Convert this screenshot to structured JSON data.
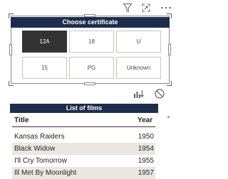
{
  "header_icons": [
    "filter-icon",
    "focus-mode-icon",
    "more-options-icon"
  ],
  "slicer": {
    "title": "Choose certificate",
    "options": [
      {
        "label": "12A",
        "selected": true
      },
      {
        "label": "18",
        "selected": false
      },
      {
        "label": "U",
        "selected": false
      },
      {
        "label": "15",
        "selected": false
      },
      {
        "label": "PG",
        "selected": false
      },
      {
        "label": "Unknown",
        "selected": false
      }
    ]
  },
  "visual_tools": [
    "drill-icon",
    "no-filter-icon"
  ],
  "table": {
    "title": "List of films",
    "columns": [
      "Title",
      "Year"
    ],
    "rows": [
      [
        "Kansas Raiders",
        "1950"
      ],
      [
        "Black Widow",
        "1954"
      ],
      [
        "I'll Cry Tomorrow",
        "1955"
      ],
      [
        "Ill Met By Moonlight",
        "1957"
      ]
    ]
  },
  "colors": {
    "title_bar": "#1f2d4d",
    "selected_tile": "#333333",
    "alt_row": "#eae6e1"
  }
}
